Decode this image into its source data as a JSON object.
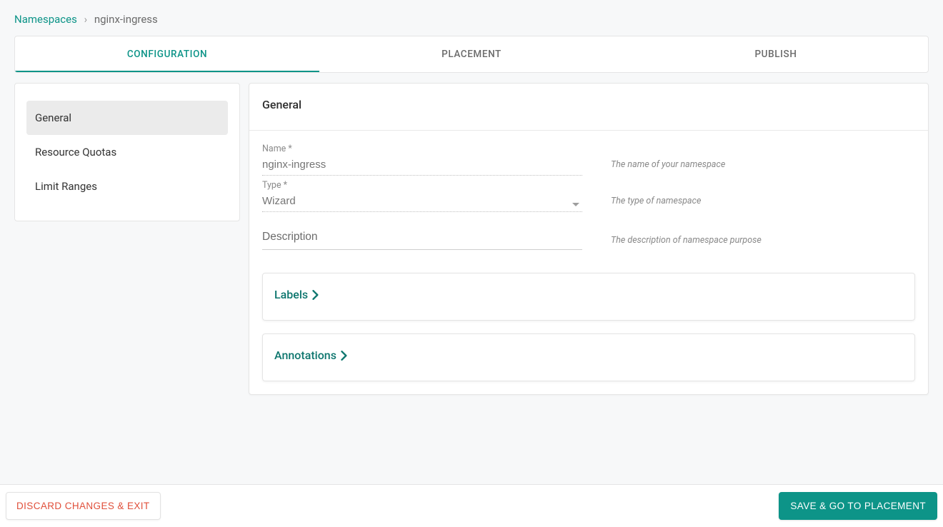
{
  "breadcrumb": {
    "root": "Namespaces",
    "separator": "›",
    "current": "nginx-ingress"
  },
  "tabs": [
    {
      "label": "CONFIGURATION",
      "active": true
    },
    {
      "label": "PLACEMENT",
      "active": false
    },
    {
      "label": "PUBLISH",
      "active": false
    }
  ],
  "sidebar": {
    "items": [
      {
        "label": "General",
        "active": true
      },
      {
        "label": "Resource Quotas",
        "active": false
      },
      {
        "label": "Limit Ranges",
        "active": false
      }
    ]
  },
  "section": {
    "title": "General"
  },
  "form": {
    "name": {
      "label": "Name *",
      "value": "nginx-ingress",
      "helper": "The name of your namespace"
    },
    "type": {
      "label": "Type *",
      "value": "Wizard",
      "helper": "The type of namespace"
    },
    "description": {
      "placeholder": "Description",
      "value": "",
      "helper": "The description of namespace purpose"
    }
  },
  "expanders": {
    "labels": "Labels",
    "annotations": "Annotations"
  },
  "footer": {
    "discard": "DISCARD CHANGES & EXIT",
    "save": "SAVE & GO TO PLACEMENT"
  }
}
